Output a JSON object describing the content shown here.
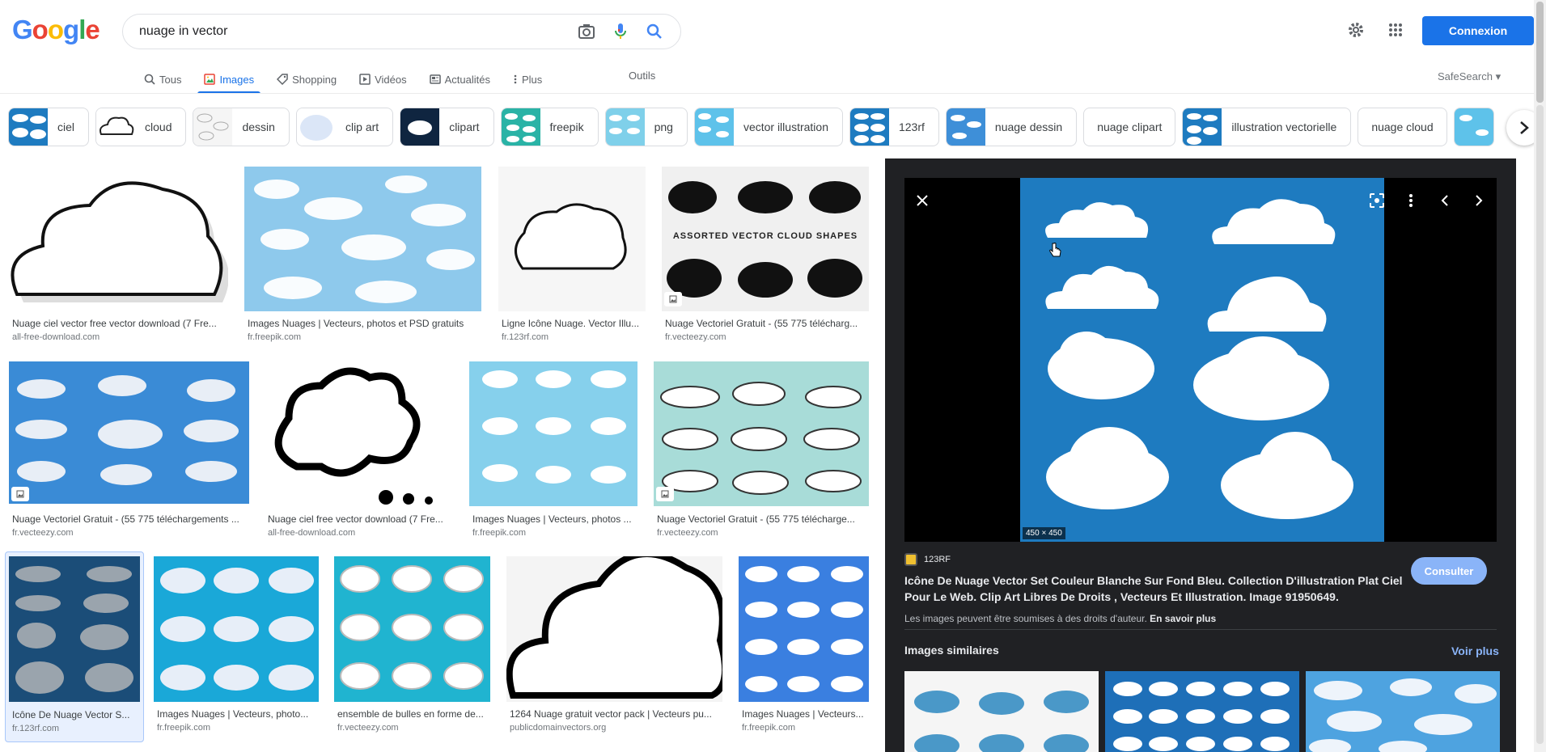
{
  "logo": {
    "letters": [
      "G",
      "o",
      "o",
      "g",
      "l",
      "e"
    ],
    "colors": [
      "#4285f4",
      "#ea4335",
      "#fbbc05",
      "#4285f4",
      "#34a853",
      "#ea4335"
    ]
  },
  "search": {
    "query": "nuage in vector"
  },
  "header": {
    "signin_label": "Connexion"
  },
  "tabs": [
    {
      "label": "Tous",
      "icon": "search-icon"
    },
    {
      "label": "Images",
      "icon": "image-icon",
      "active": true
    },
    {
      "label": "Shopping",
      "icon": "tag-icon"
    },
    {
      "label": "Vidéos",
      "icon": "play-icon"
    },
    {
      "label": "Actualités",
      "icon": "news-icon"
    },
    {
      "label": "Plus",
      "icon": "more-vert-icon"
    }
  ],
  "tools_label": "Outils",
  "safesearch_label": "SafeSearch",
  "chips": [
    "ciel",
    "cloud",
    "dessin",
    "clip art",
    "clipart",
    "freepik",
    "png",
    "vector illustration",
    "123rf",
    "nuage dessin",
    "nuage clipart",
    "illustration vectorielle",
    "nuage cloud"
  ],
  "results": [
    {
      "caption": "Nuage ciel vector free vector download (7 Fre...",
      "source": "all-free-download.com"
    },
    {
      "caption": "Images Nuages | Vecteurs, photos et PSD gratuits",
      "source": "fr.freepik.com"
    },
    {
      "caption": "Ligne Icône Nuage. Vector Illu...",
      "source": "fr.123rf.com"
    },
    {
      "caption": "Nuage Vectoriel Gratuit - (55 775 télécharg...",
      "source": "fr.vecteezy.com",
      "overlay": "ASSORTED VECTOR CLOUD SHAPES"
    },
    {
      "caption": "Nuage Vectoriel Gratuit - (55 775 téléchargements ...",
      "source": "fr.vecteezy.com"
    },
    {
      "caption": "Nuage ciel free vector download (7 Fre...",
      "source": "all-free-download.com"
    },
    {
      "caption": "Images Nuages | Vecteurs, photos ...",
      "source": "fr.freepik.com"
    },
    {
      "caption": "Nuage Vectoriel Gratuit - (55 775 télécharge...",
      "source": "fr.vecteezy.com"
    },
    {
      "caption": "Icône De Nuage Vector S...",
      "source": "fr.123rf.com"
    },
    {
      "caption": "Images Nuages | Vecteurs, photo...",
      "source": "fr.freepik.com"
    },
    {
      "caption": "ensemble de bulles en forme de...",
      "source": "fr.vecteezy.com"
    },
    {
      "caption": "1264 Nuage gratuit vector pack | Vecteurs pu...",
      "source": "publicdomainvectors.org"
    },
    {
      "caption": "Images Nuages | Vecteurs...",
      "source": "fr.freepik.com"
    }
  ],
  "preview": {
    "size": "450 × 450",
    "site": "123RF",
    "title": "Icône De Nuage Vector Set Couleur Blanche Sur Fond Bleu. Collection D'illustration Plat Ciel Pour Le Web. Clip Art Libres De Droits , Vecteurs Et Illustration. Image 91950649.",
    "visit_label": "Consulter",
    "rights_text": "Les images peuvent être soumises à des droits d'auteur.",
    "rights_link": "En savoir plus",
    "similar_title": "Images similaires",
    "similar_more": "Voir plus"
  }
}
